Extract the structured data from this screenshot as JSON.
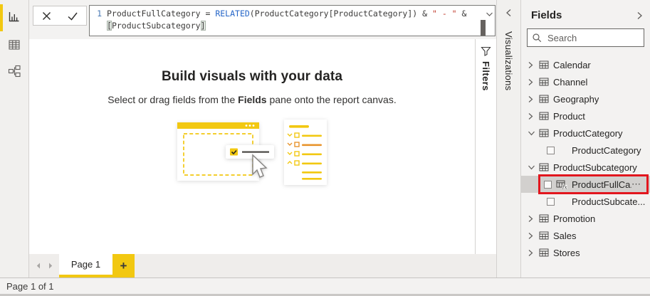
{
  "app": {
    "accent_yellow": "#f2c811",
    "annotation_red": "#e2161e"
  },
  "nav_rail": {
    "items": [
      {
        "name": "report-view",
        "active": true
      },
      {
        "name": "data-view",
        "active": false
      },
      {
        "name": "model-view",
        "active": false
      }
    ]
  },
  "formula_bar": {
    "line_number": "1",
    "tokens": {
      "plain_start": "ProductFullCategory = ",
      "keyword": "RELATED",
      "plain_mid": "(ProductCategory[ProductCategory]) & ",
      "string_literal": "\" - \"",
      "plain_end": " &",
      "line2_open_bracket": "[",
      "line2_name": "ProductSubcategory",
      "line2_close_bracket": "]"
    }
  },
  "canvas": {
    "empty_title": "Build visuals with your data",
    "subtitle_pre": "Select or drag fields from the ",
    "subtitle_bold": "Fields",
    "subtitle_post": " pane onto the report canvas."
  },
  "filters_pane": {
    "label": "Filters"
  },
  "visualizations_pane": {
    "label": "Visualizations"
  },
  "fields_pane": {
    "title": "Fields",
    "search_placeholder": "Search",
    "items": [
      {
        "type": "table",
        "label": "Calendar",
        "expanded": false
      },
      {
        "type": "table",
        "label": "Channel",
        "expanded": false
      },
      {
        "type": "table",
        "label": "Geography",
        "expanded": false
      },
      {
        "type": "table",
        "label": "Product",
        "expanded": false
      },
      {
        "type": "table",
        "label": "ProductCategory",
        "expanded": true
      },
      {
        "type": "field",
        "label": "ProductCategory"
      },
      {
        "type": "table",
        "label": "ProductSubcategory",
        "expanded": true
      },
      {
        "type": "calc-field",
        "label": "ProductFullCa...",
        "selected": true,
        "highlighted": true,
        "more_label": "⋯"
      },
      {
        "type": "field",
        "label": "ProductSubcate..."
      },
      {
        "type": "table",
        "label": "Promotion",
        "expanded": false
      },
      {
        "type": "table",
        "label": "Sales",
        "expanded": false
      },
      {
        "type": "table",
        "label": "Stores",
        "expanded": false
      }
    ]
  },
  "page_tabs": {
    "active_tab": "Page 1",
    "add_label": "+"
  },
  "status_bar": {
    "text": "Page 1 of 1"
  }
}
